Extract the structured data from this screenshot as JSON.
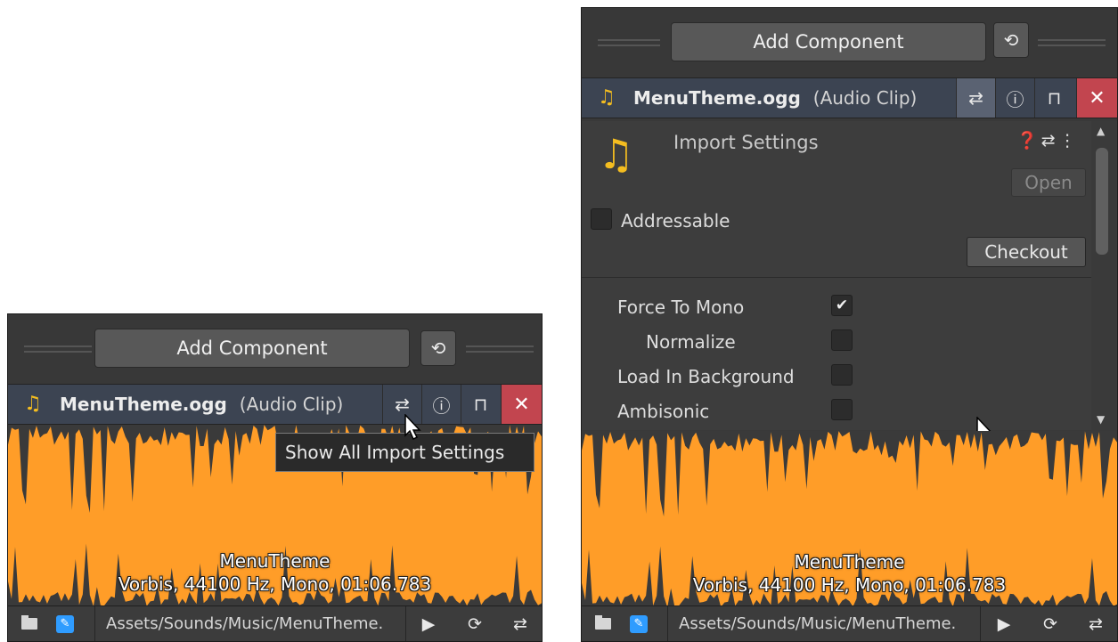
{
  "inspector": {
    "add_component_label": "Add Component",
    "history_icon": "history-icon",
    "asset_title": "MenuTheme.ogg",
    "asset_type": "(Audio Clip)",
    "header_icons": [
      "sliders-icon",
      "info-icon",
      "lock-icon",
      "close-icon"
    ],
    "accent_color": "#ff9d28",
    "close_color": "#c2454f"
  },
  "tooltip": {
    "text": "Show All Import Settings"
  },
  "waveform": {
    "clip_name": "MenuTheme",
    "clip_info": "Vorbis, 44100 Hz, Mono, 01:06.783"
  },
  "toolbar": {
    "path": "Assets/Sounds/Music/MenuTheme.",
    "icons": [
      "folder-icon",
      "edit-icon",
      "play-icon",
      "auto-play-icon",
      "loop-icon"
    ]
  },
  "import_settings": {
    "title": "Import Settings",
    "open_label": "Open",
    "addressable_label": "Addressable",
    "addressable_checked": false,
    "checkout_label": "Checkout",
    "options": [
      {
        "label": "Force To Mono",
        "checked": true
      },
      {
        "label": "Normalize",
        "checked": false
      },
      {
        "label": "Load In Background",
        "checked": false
      },
      {
        "label": "Ambisonic",
        "checked": false
      }
    ]
  }
}
